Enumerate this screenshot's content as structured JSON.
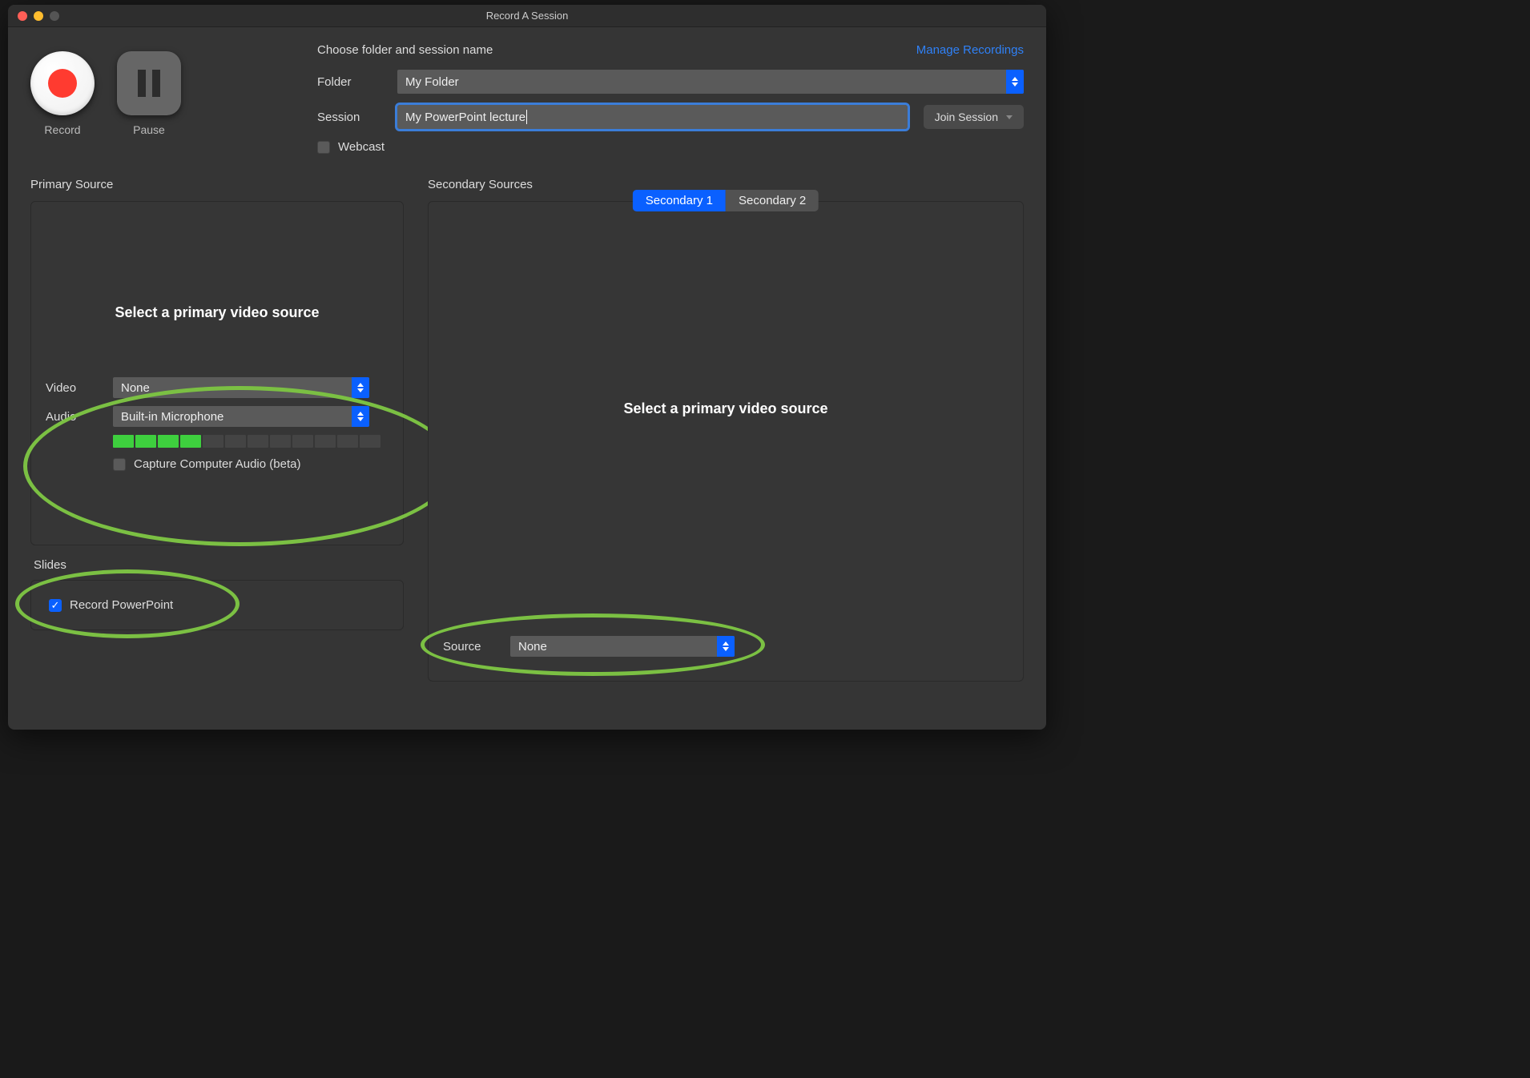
{
  "window": {
    "title": "Record A Session"
  },
  "controls": {
    "record_label": "Record",
    "pause_label": "Pause"
  },
  "form": {
    "heading": "Choose folder and session name",
    "manage_link": "Manage Recordings",
    "folder_label": "Folder",
    "folder_value": "My Folder",
    "session_label": "Session",
    "session_value": "My PowerPoint lecture",
    "join_button": "Join Session",
    "webcast_label": "Webcast",
    "webcast_checked": false
  },
  "primary": {
    "title": "Primary Source",
    "placeholder": "Select a primary video source",
    "video_label": "Video",
    "video_value": "None",
    "audio_label": "Audio",
    "audio_value": "Built-in Microphone",
    "level_segments": 12,
    "level_active": 4,
    "capture_label": "Capture Computer Audio (beta)",
    "capture_checked": false
  },
  "slides": {
    "title": "Slides",
    "record_ppt_label": "Record PowerPoint",
    "record_ppt_checked": true
  },
  "secondary": {
    "title": "Secondary Sources",
    "tabs": [
      "Secondary 1",
      "Secondary 2"
    ],
    "active_tab": 0,
    "placeholder": "Select a primary video source",
    "source_label": "Source",
    "source_value": "None"
  }
}
